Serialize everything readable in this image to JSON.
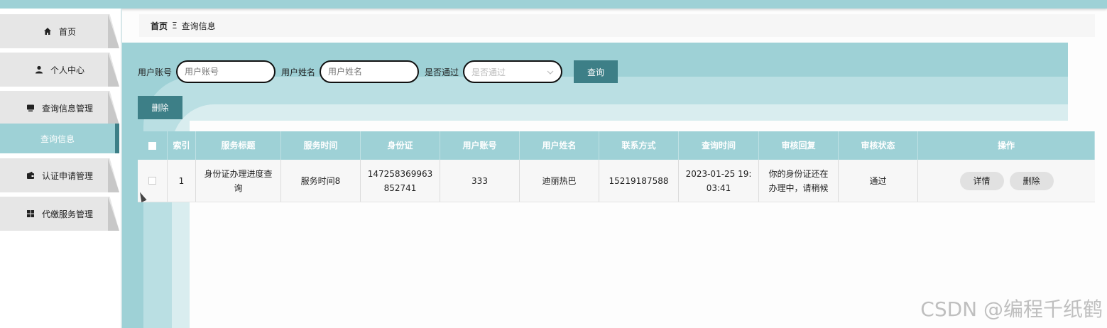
{
  "sidebar": {
    "items": [
      {
        "label": "首页",
        "icon": "home-icon"
      },
      {
        "label": "个人中心",
        "icon": "user-icon"
      },
      {
        "label": "查询信息管理",
        "icon": "monitor-icon"
      },
      {
        "label": "认证申请管理",
        "icon": "wallet-icon"
      },
      {
        "label": "代缴服务管理",
        "icon": "grid-icon"
      }
    ],
    "active_sub": "查询信息"
  },
  "breadcrumb": {
    "home": "首页",
    "separator": "Ξ",
    "current": "查询信息"
  },
  "search": {
    "account_label": "用户账号",
    "account_placeholder": "用户账号",
    "name_label": "用户姓名",
    "name_placeholder": "用户姓名",
    "pass_label": "是否通过",
    "pass_placeholder": "是否通过",
    "query_button": "查询"
  },
  "toolbar": {
    "delete_button": "删除"
  },
  "table": {
    "headers": [
      "索引",
      "服务标题",
      "服务时间",
      "身份证",
      "用户账号",
      "用户姓名",
      "联系方式",
      "查询时间",
      "审核回复",
      "审核状态",
      "操作"
    ],
    "rows": [
      {
        "index": "1",
        "title": "身份证办理进度查询",
        "service_time": "服务时间8",
        "id_card": "147258369963852741",
        "account": "333",
        "name": "迪丽热巴",
        "phone": "15219187588",
        "query_time": "2023-01-25 19:03:41",
        "reply": "你的身份证还在办理中，请稍候",
        "status": "通过",
        "detail_button": "详情",
        "delete_button": "删除"
      }
    ]
  },
  "watermark": "CSDN @编程千纸鹤",
  "colors": {
    "accent": "#3d7f87",
    "teal_light": "#9ed1d6"
  }
}
